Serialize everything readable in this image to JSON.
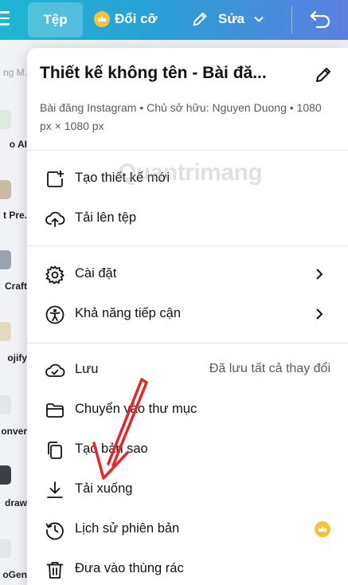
{
  "topbar": {
    "file_label": "Tệp",
    "resize_label": "Đổi cỡ",
    "edit_label": "Sửa"
  },
  "sidebar": {
    "items": [
      {
        "label": "ng M."
      },
      {
        "label": "o AI"
      },
      {
        "label": "t Pre."
      },
      {
        "label": "Craft"
      },
      {
        "label": "ojify"
      },
      {
        "label": "onver"
      },
      {
        "label": "draw"
      },
      {
        "label": "oGen"
      }
    ]
  },
  "panel": {
    "title": "Thiết kế không tên - Bài đă...",
    "meta": "Bài đăng Instagram • Chủ sở hữu: Nguyen Duong • 1080 px × 1080 px",
    "items": {
      "new_design": "Tạo thiết kế mới",
      "upload": "Tải lên tệp",
      "settings": "Cài đặt",
      "accessibility": "Khả năng tiếp cận",
      "save": "Lưu",
      "save_status": "Đã lưu tất cả thay đổi",
      "move_folder": "Chuyển vào thư mục",
      "copy": "Tạo bản sao",
      "download": "Tải xuống",
      "version_history": "Lịch sử phiên bản",
      "trash": "Đưa vào thùng rác"
    }
  },
  "watermark": "Quantrimang",
  "colors": {
    "topbar_start": "#1fb6d2",
    "topbar_end": "#5b7fe0",
    "crown": "#f6c43a",
    "annotation_arrow": "#e8262a"
  }
}
